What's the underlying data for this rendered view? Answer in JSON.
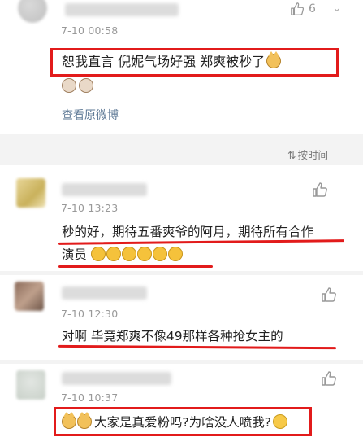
{
  "comments": [
    {
      "time": "7-10 00:58",
      "text": "恕我直言  倪妮气场好强  郑爽被秒了",
      "likes": "6",
      "link": "查看原微博"
    },
    {
      "time": "7-10 13:23",
      "text_line1": "秒的好，期待五番爽爷的阿月，期待所有合作",
      "text_line2": "演员"
    },
    {
      "time": "7-10 12:30",
      "text": "对啊 毕竟郑爽不像49那样各种抢女主的"
    },
    {
      "time": "7-10 10:37",
      "text": "大家是真爱粉吗?为啥没人喷我?"
    }
  ],
  "sort_label": "按时间",
  "icons": [
    "thumbs-up-icon",
    "sort-icon",
    "cat-emoji",
    "cry-emoji",
    "smirk-emoji"
  ],
  "accent_red": "#e21b1b",
  "link_color": "#5d7895"
}
